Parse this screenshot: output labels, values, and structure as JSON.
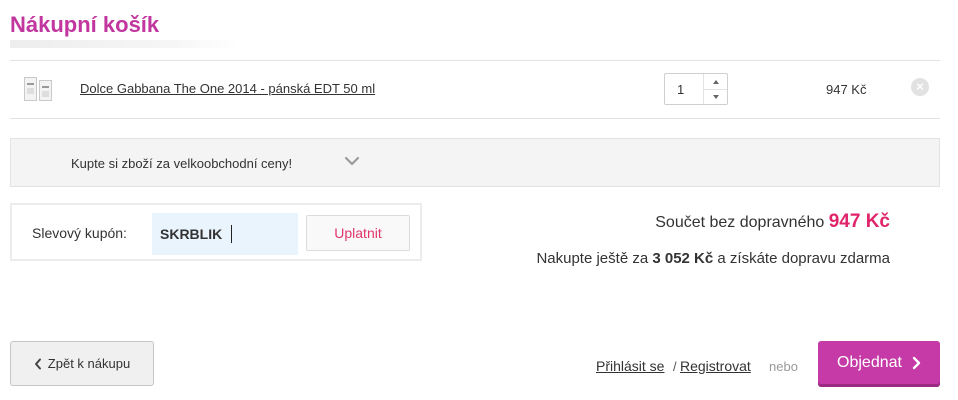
{
  "page": {
    "title": "Nákupní košík"
  },
  "cart": {
    "items": [
      {
        "name": "Dolce Gabbana The One 2014 - pánská EDT 50 ml",
        "quantity": "1",
        "price": "947 Kč",
        "thumbnail_icon": "perfume-bottle-icon",
        "remove_icon": "remove-icon"
      }
    ]
  },
  "wholesale": {
    "text": "Kupte si zboží za velkoobchodní ceny!",
    "icon": "chevron-down-icon"
  },
  "coupon": {
    "label": "Slevový kupón:",
    "value": "SKRBLIK",
    "apply_label": "Uplatnit"
  },
  "totals": {
    "subtotal_label": "Součet bez dopravného",
    "subtotal_amount": "947 Kč",
    "free_shipping_prefix": "Nakupte ještě za",
    "free_shipping_amount": "3 052 Kč",
    "free_shipping_suffix": "a získáte dopravu zdarma"
  },
  "actions": {
    "back_label": "Zpět k nákupu",
    "login_label": "Přihlásit se",
    "separator": "/",
    "register_label": "Registrovat",
    "or_label": "nebo",
    "order_label": "Objednat"
  },
  "colors": {
    "brand": "#c2379f",
    "accent_price": "#e0246b",
    "order_button": "#c53aa7",
    "coupon_input_bg": "#eaf4fc"
  }
}
